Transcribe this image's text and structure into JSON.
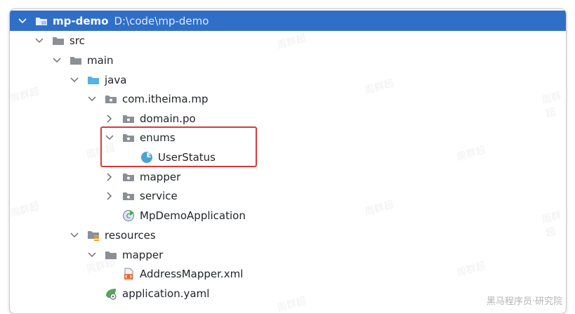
{
  "project": {
    "name": "mp-demo",
    "path": "D:\\code\\mp-demo"
  },
  "tree": {
    "src": "src",
    "main": "main",
    "java": "java",
    "package": "com.itheima.mp",
    "domain_po": "domain.po",
    "enums": "enums",
    "user_status": "UserStatus",
    "enum_badge": "E",
    "mapper_pkg": "mapper",
    "service": "service",
    "app_class": "MpDemoApplication",
    "resources": "resources",
    "res_mapper": "mapper",
    "address_mapper": "AddressMapper.xml",
    "application_yaml": "application.yaml"
  },
  "watermark": {
    "tile_text": "周群超",
    "corner_text": "黑马程序员·研究院"
  },
  "colors": {
    "selection": "#2f6fc8",
    "highlight_border": "#d83a3a",
    "folder": "#8b8f96",
    "source_folder": "#55b1e6",
    "enum_badge": "#4aa3d8"
  }
}
